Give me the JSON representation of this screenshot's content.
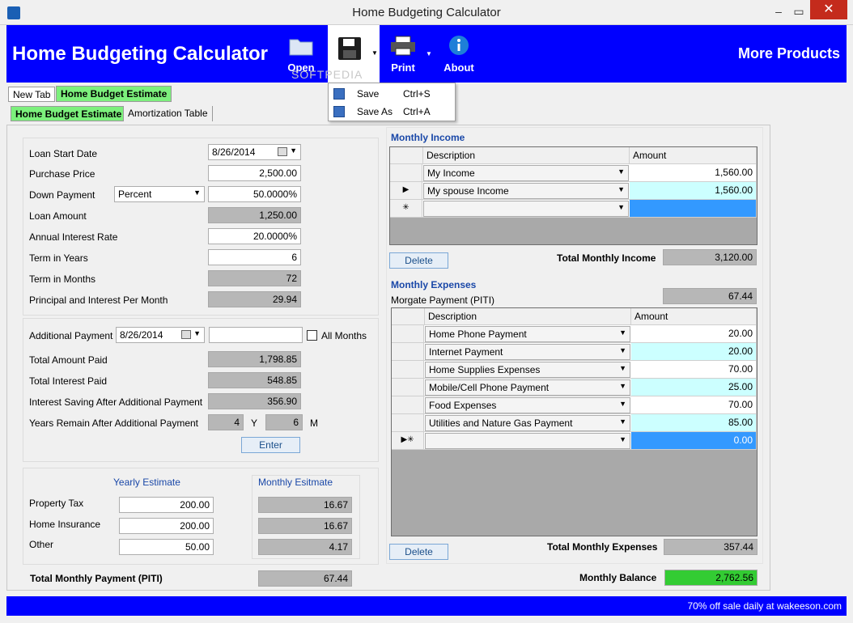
{
  "window": {
    "title": "Home Budgeting Calculator"
  },
  "banner": {
    "title": "Home Budgeting Calculator",
    "more_products": "More Products"
  },
  "toolbar": {
    "open": "Open",
    "print": "Print",
    "about": "About"
  },
  "watermark": "SOFTPEDIA",
  "save_menu": {
    "save": {
      "label": "Save",
      "shortcut": "Ctrl+S"
    },
    "save_as": {
      "label": "Save As",
      "shortcut": "Ctrl+A"
    }
  },
  "doc_tabs": {
    "new_tab": "New Tab",
    "home_budget": "Home Budget Estimate"
  },
  "sub_tabs": {
    "home_budget": "Home Budget Estimate",
    "amortization": "Amortization Table"
  },
  "loan": {
    "start_date_label": "Loan Start Date",
    "start_date": "8/26/2014",
    "purchase_price_label": "Purchase Price",
    "purchase_price": "2,500.00",
    "down_payment_label": "Down Payment",
    "down_payment_type": "Percent",
    "down_payment": "50.0000%",
    "loan_amount_label": "Loan Amount",
    "loan_amount": "1,250.00",
    "interest_rate_label": "Annual Interest Rate",
    "interest_rate": "20.0000%",
    "term_years_label": "Term in Years",
    "term_years": "6",
    "term_months_label": "Term in Months",
    "term_months": "72",
    "pi_label": "Principal and Interest Per Month",
    "pi": "29.94"
  },
  "additional": {
    "label": "Additional Payment",
    "date": "8/26/2014",
    "amount": "",
    "all_months": "All Months",
    "total_paid_label": "Total Amount  Paid",
    "total_paid": "1,798.85",
    "total_interest_label": "Total Interest Paid",
    "total_interest": "548.85",
    "saving_label": "Interest Saving After Additional Payment",
    "saving": "356.90",
    "years_remain_label": "Years Remain After Additional Payment",
    "years": "4",
    "y": "Y",
    "months": "6",
    "m": "M",
    "enter": "Enter"
  },
  "escrow": {
    "yearly_header": "Yearly Estimate",
    "monthly_header": "Monthly Esitmate",
    "property_tax_label": "Property Tax",
    "property_tax": "200.00",
    "property_tax_m": "16.67",
    "insurance_label": "Home Insurance",
    "insurance": "200.00",
    "insurance_m": "16.67",
    "other_label": "Other",
    "other": "50.00",
    "other_m": "4.17",
    "total_label": "Total Monthly Payment (PITI)",
    "total": "67.44"
  },
  "income": {
    "header": "Monthly Income",
    "col_desc": "Description",
    "col_amount": "Amount",
    "rows": [
      {
        "desc": "My Income",
        "amount": "1,560.00"
      },
      {
        "desc": "My spouse Income",
        "amount": "1,560.00"
      }
    ],
    "delete": "Delete",
    "total_label": "Total Monthly Income",
    "total": "3,120.00"
  },
  "expenses": {
    "header": "Monthly Expenses",
    "mortgage_label": "Morgate Payment (PITI)",
    "mortgage": "67.44",
    "col_desc": "Description",
    "col_amount": "Amount",
    "rows": [
      {
        "desc": "Home Phone Payment",
        "amount": "20.00"
      },
      {
        "desc": "Internet Payment",
        "amount": "20.00"
      },
      {
        "desc": "Home Supplies Expenses",
        "amount": "70.00"
      },
      {
        "desc": "Mobile/Cell Phone Payment",
        "amount": "25.00"
      },
      {
        "desc": "Food Expenses",
        "amount": "70.00"
      },
      {
        "desc": "Utilities and Nature Gas Payment",
        "amount": "85.00"
      }
    ],
    "new_row_amount": "0.00",
    "delete": "Delete",
    "total_label": "Total Monthly Expenses",
    "total": "357.44",
    "balance_label": "Monthly Balance",
    "balance": "2,762.56"
  },
  "footer": {
    "text": "70% off sale daily at wakeeson.com"
  },
  "colors": {
    "banner": "#0000ff",
    "tab_active": "#7cf07c",
    "cell_cyan": "#ccffff",
    "balance": "#33cc33",
    "new_row": "#3399ff"
  }
}
